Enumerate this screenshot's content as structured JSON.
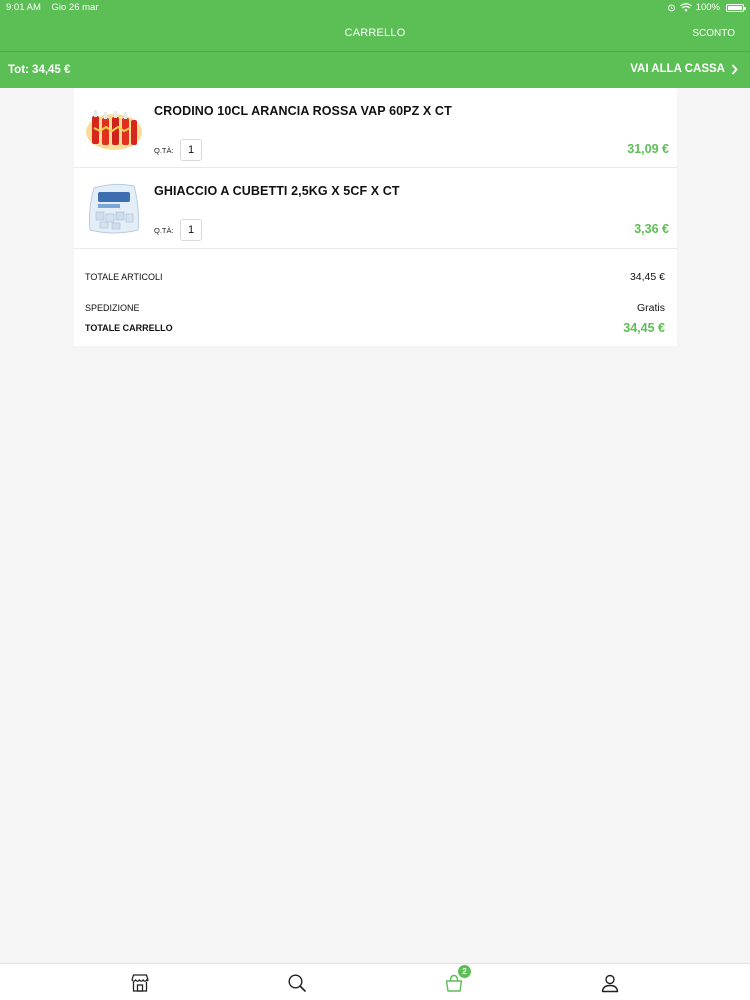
{
  "status_bar": {
    "time": "9:01 AM",
    "date": "Gio 26 mar",
    "battery": "100%",
    "icons": [
      "alarm-icon",
      "wifi-icon",
      "battery-icon"
    ]
  },
  "header": {
    "title": "CARRELLO",
    "action": "SCONTO"
  },
  "total_bar": {
    "total": "Tot: 34,45 €",
    "checkout": "VAI ALLA CASSA",
    "checkout_icon": "chevron-right-icon"
  },
  "cart": {
    "items": [
      {
        "name": "CRODINO 10CL ARANCIA ROSSA VAP 60PZ X CT",
        "qty_label": "Q.TÀ:",
        "qty": "1",
        "price": "31,09 €",
        "image": "crodino-bottles-product-image"
      },
      {
        "name": "GHIACCIO A CUBETTI 2,5KG X 5CF X CT",
        "qty_label": "Q.TÀ:",
        "qty": "1",
        "price": "3,36 €",
        "image": "ice-cubes-bag-product-image"
      }
    ],
    "summary": {
      "items_label": "TOTALE ARTICOLI",
      "items_value": "34,45 €",
      "shipping_label": "SPEDIZIONE",
      "shipping_value": "Gratis",
      "total_label": "TOTALE CARRELLO",
      "total_value": "34,45 €"
    }
  },
  "tab_bar": {
    "tabs": [
      "store-icon",
      "search-icon",
      "cart-icon",
      "user-icon"
    ],
    "cart_badge": "2"
  },
  "colors": {
    "accent": "#5cbf55",
    "background": "#f5f5f5"
  }
}
